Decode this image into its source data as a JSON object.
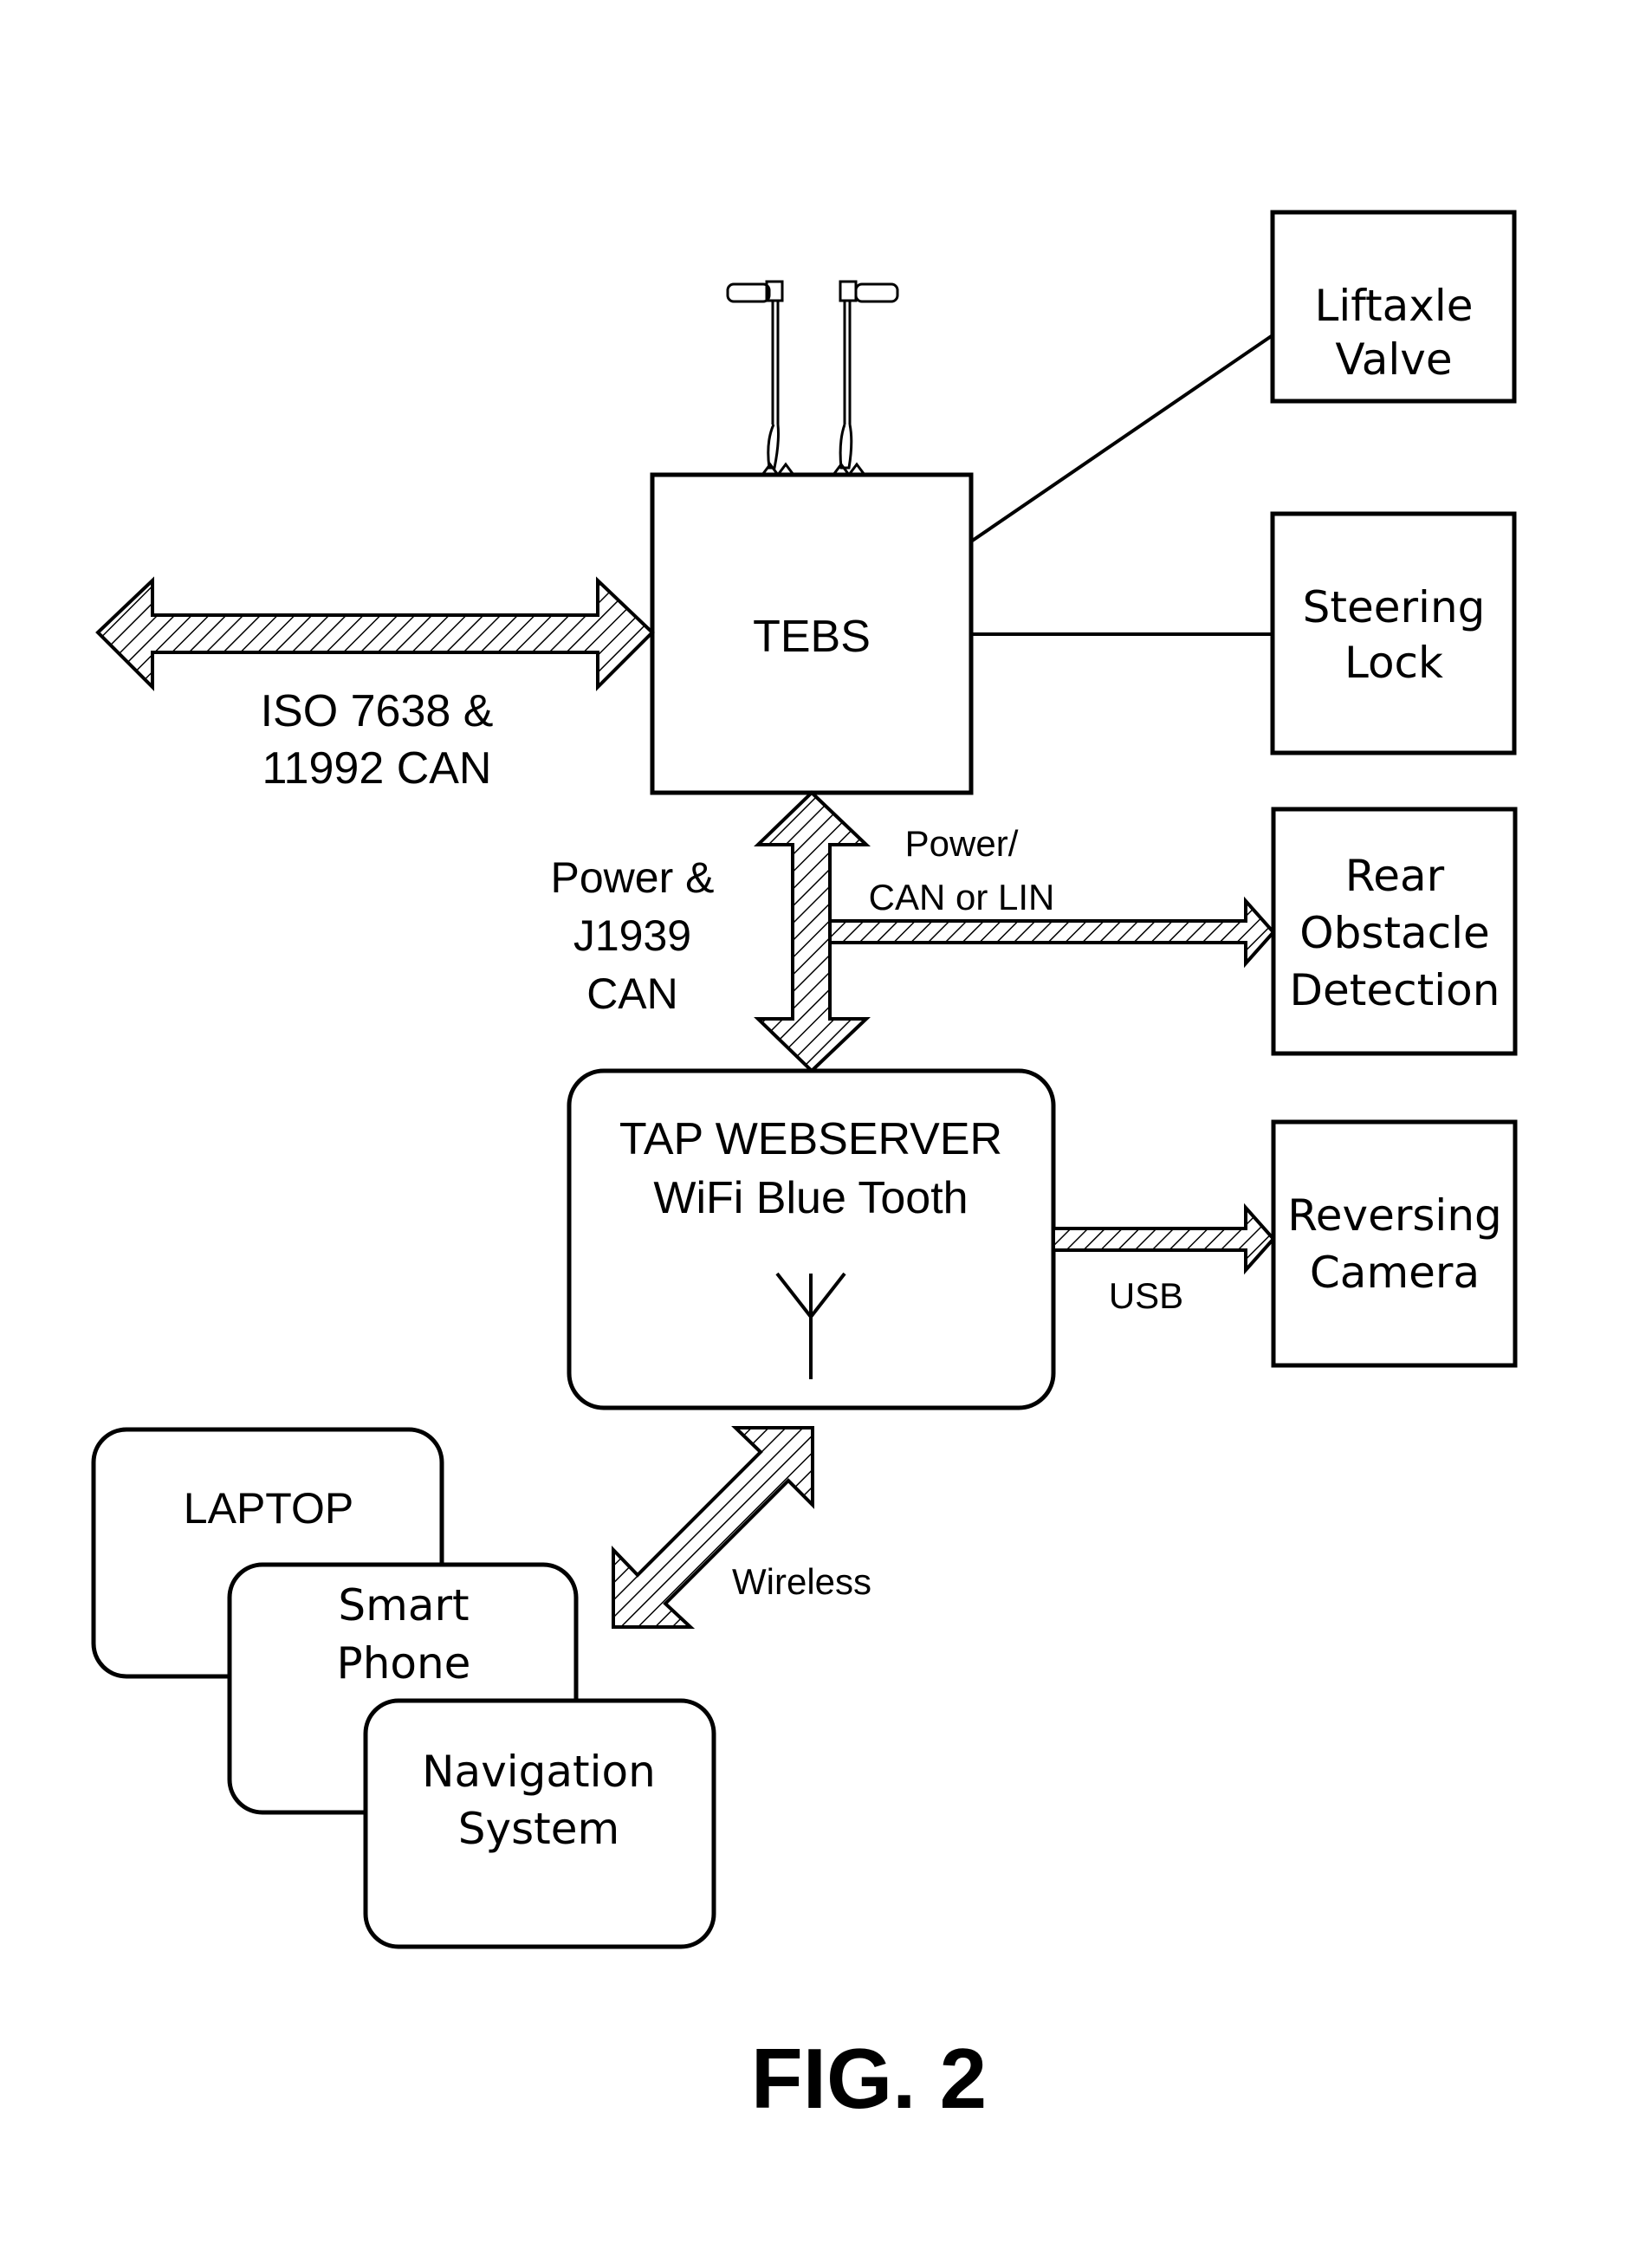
{
  "figure": {
    "caption": "FIG. 2"
  },
  "nodes": {
    "tebs": {
      "label": "TEBS"
    },
    "liftaxle_valve": {
      "lines": [
        "Liftaxle",
        "Valve"
      ]
    },
    "steering_lock": {
      "lines": [
        "Steering",
        "Lock"
      ]
    },
    "rear_obstacle_detection": {
      "lines": [
        "Rear",
        "Obstacle",
        "Detection"
      ]
    },
    "reversing_camera": {
      "lines": [
        "Reversing",
        "Camera"
      ]
    },
    "tap_webserver": {
      "lines": [
        "TAP  WEBSERVER",
        "WiFi  Blue  Tooth"
      ],
      "icon": "antenna-icon"
    },
    "laptop": {
      "label": "LAPTOP"
    },
    "smart_phone": {
      "lines": [
        "Smart",
        "Phone"
      ]
    },
    "navigation_system": {
      "lines": [
        "Navigation",
        "System"
      ]
    }
  },
  "connections": {
    "iso_can": {
      "lines": [
        "ISO  7638  &",
        "11992  CAN"
      ],
      "type": "bidirectional-hatched-arrow"
    },
    "power_j1939": {
      "lines": [
        "Power  &",
        "J1939",
        "CAN"
      ],
      "type": "bidirectional-hatched-arrow"
    },
    "power_can_lin": {
      "lines": [
        "Power/",
        "CAN  or  LIN"
      ],
      "type": "hatched-arrow"
    },
    "usb": {
      "label": "USB",
      "type": "hatched-arrow"
    },
    "wireless": {
      "label": "Wireless",
      "type": "bidirectional-hatched-arrow"
    },
    "tebs_liftaxle": {
      "type": "line"
    },
    "tebs_steering": {
      "type": "line"
    }
  },
  "antennas": {
    "count": 2,
    "icon": "antenna-icon"
  }
}
